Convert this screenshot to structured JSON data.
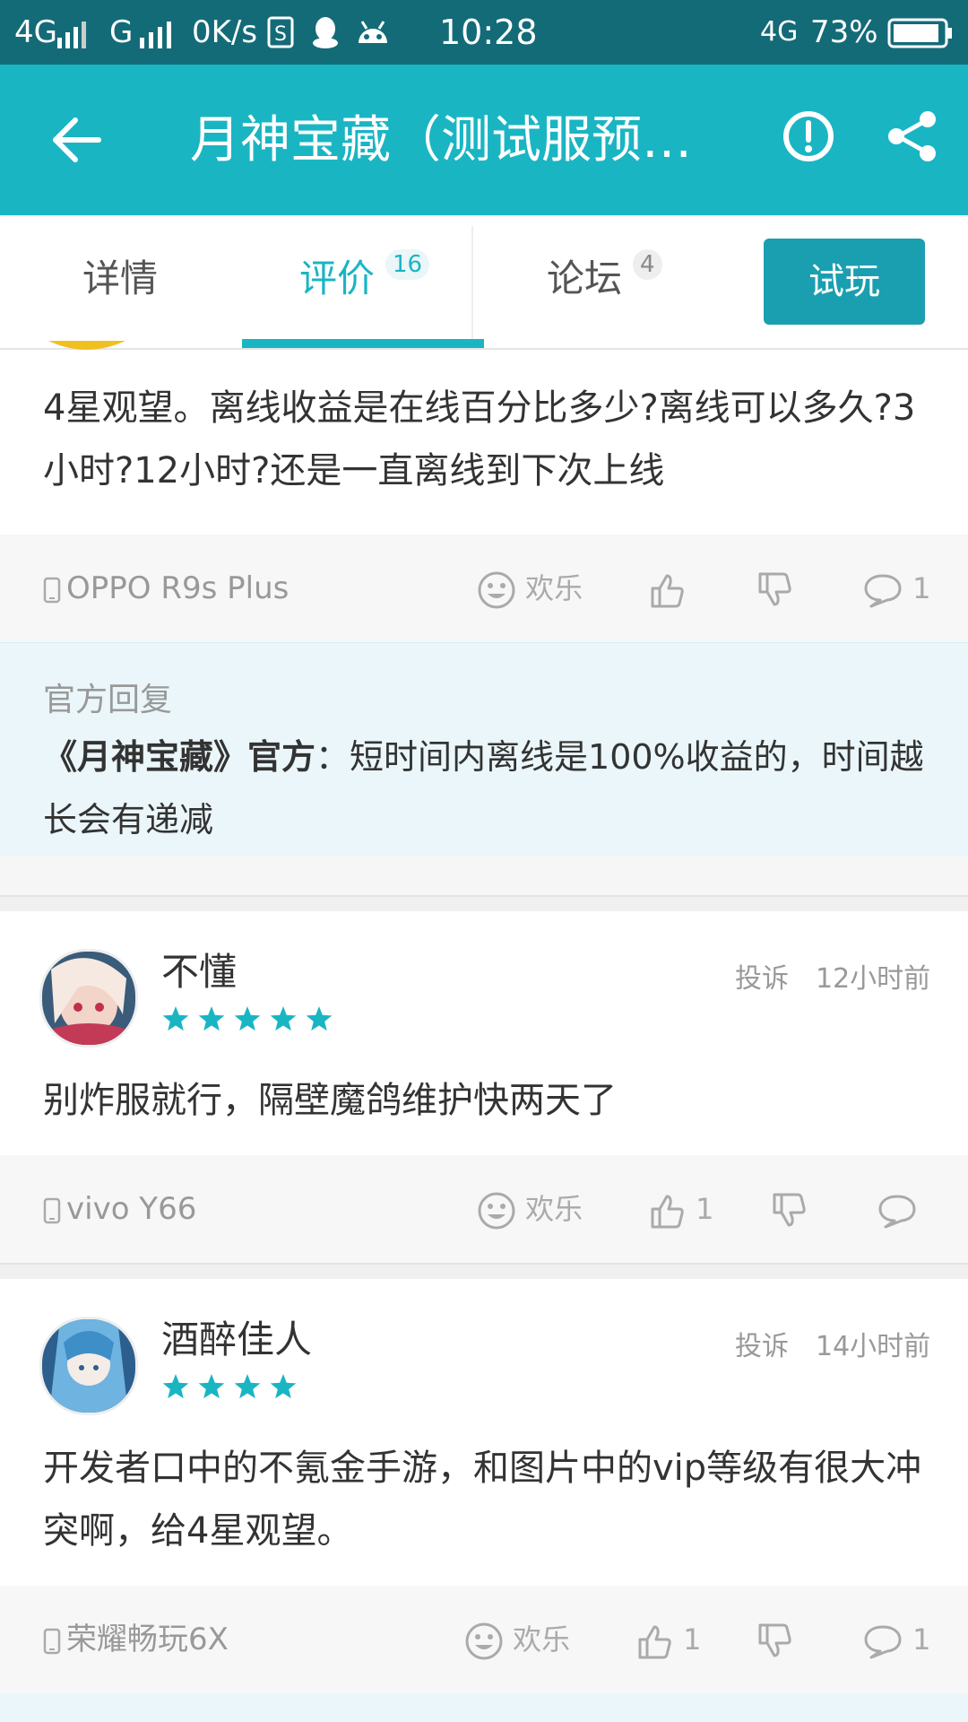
{
  "status_bar": {
    "network1": "4G",
    "network2": "G",
    "speed": "0K/s",
    "time": "10:28",
    "network3": "4G",
    "battery": "73%"
  },
  "title_bar": {
    "title": "月神宝藏（测试服预…",
    "back_icon": "arrow-left-icon",
    "report_icon": "alert-circle-icon",
    "share_icon": "share-icon"
  },
  "tabs": [
    {
      "label": "详情"
    },
    {
      "label": "评价",
      "count": "16",
      "active": true
    },
    {
      "label": "论坛",
      "count": "4"
    }
  ],
  "trial_button": "试玩",
  "colors": {
    "accent": "#1ab5c3",
    "accent_dark": "#1a9fb0",
    "status_bar": "#146b78"
  },
  "reviews": [
    {
      "text": "4星观望。离线收益是在线百分比多少?离线可以多久?3小时?12小时?还是一直离线到下次上线",
      "device": "OPPO R9s Plus",
      "mood": "欢乐",
      "likes": "",
      "comments": "1",
      "official_reply": {
        "label": "官方回复",
        "author": "《月神宝藏》官方",
        "sep": "：",
        "text": "短时间内离线是100%收益的，时间越长会有递减"
      }
    },
    {
      "username": "不懂",
      "stars": 5,
      "report": "投诉",
      "time": "12小时前",
      "text": "别炸服就行，隔壁魔鸽维护快两天了",
      "device": "vivo Y66",
      "mood": "欢乐",
      "likes": "1",
      "comments": ""
    },
    {
      "username": "酒醉佳人",
      "stars": 4,
      "report": "投诉",
      "time": "14小时前",
      "text": "开发者口中的不氪金手游，和图片中的vip等级有很大冲突啊，给4星观望。",
      "device": "荣耀畅玩6X",
      "mood": "欢乐",
      "likes": "1",
      "comments": "1"
    }
  ]
}
